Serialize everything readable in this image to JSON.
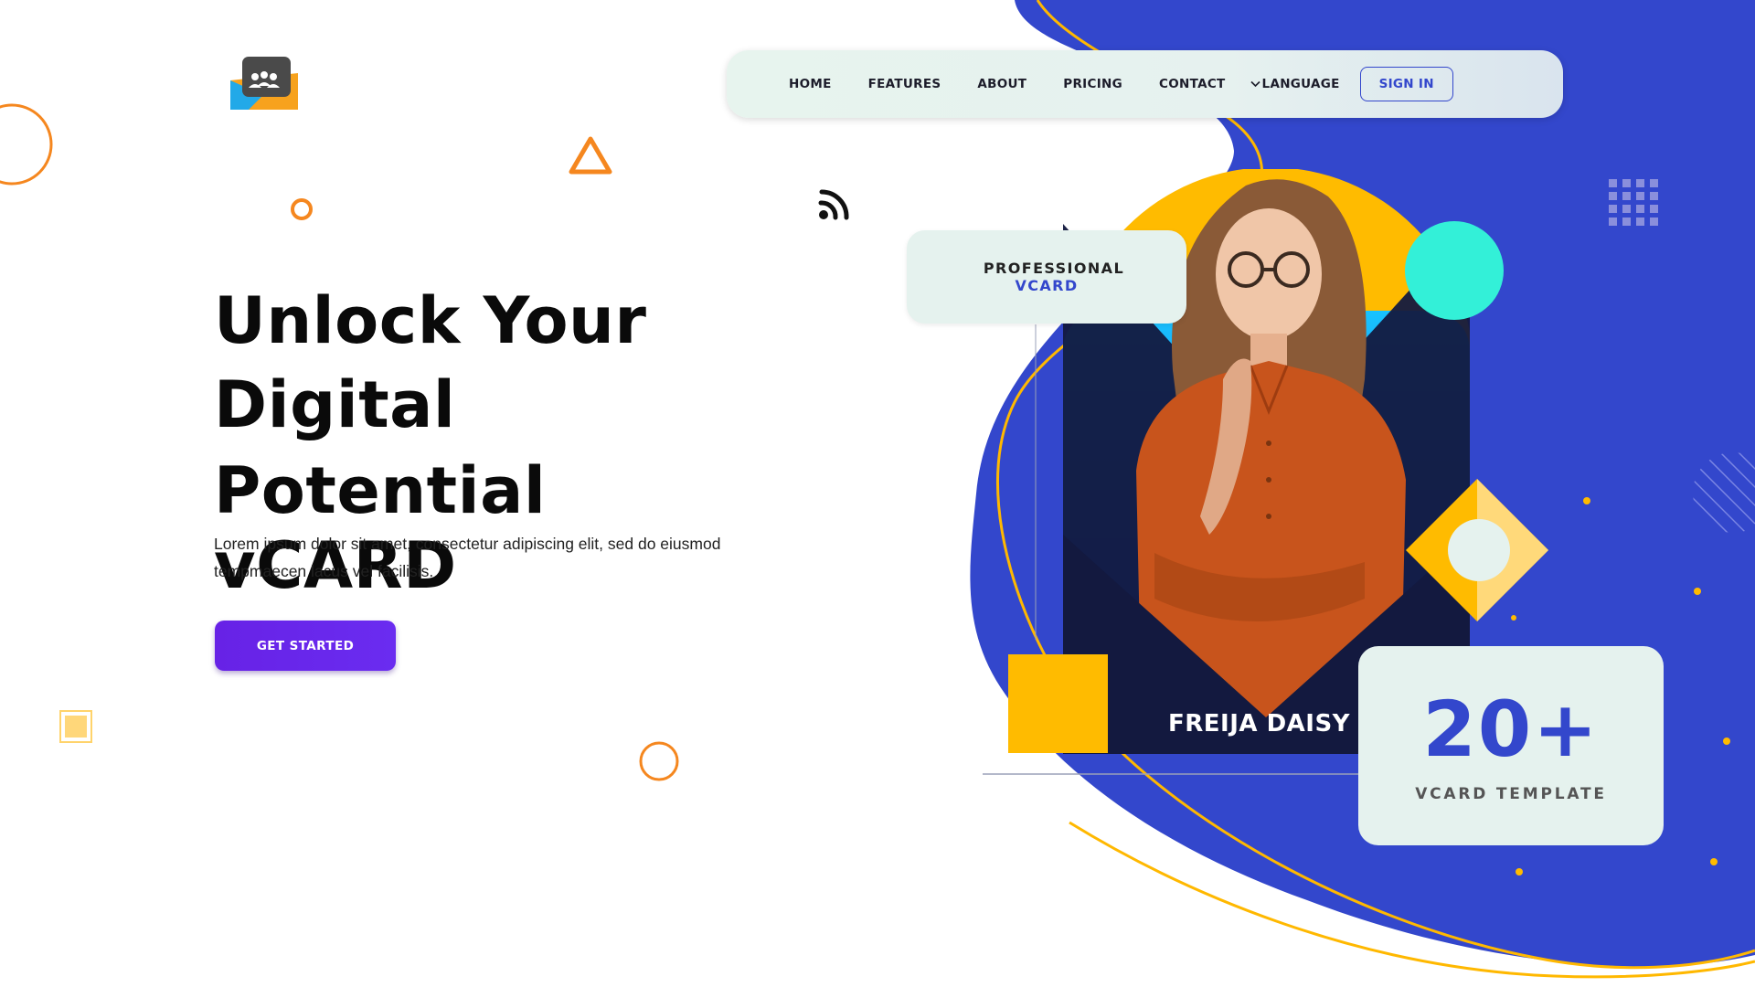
{
  "nav": {
    "home": "HOME",
    "features": "FEATURES",
    "about": "ABOUT",
    "pricing": "PRICING",
    "contact": "CONTACT",
    "language": "LANGUAGE",
    "sign_in": "SIGN IN"
  },
  "hero": {
    "title_line1": "Unlock Your Digital",
    "title_line2": "Potential",
    "title_line3": "vCARD",
    "subtitle": "Lorem ipsum dolor sit amet, consectetur adipiscing elit, sed do eiusmod tempmaecen lacus vel facilisis.",
    "cta_label": "GET STARTED"
  },
  "badge": {
    "line1": "PROFESSIONAL",
    "line2": "VCARD"
  },
  "card": {
    "name": "FREIJA DAISY"
  },
  "stats": {
    "number": "20+",
    "label": "VCARD TEMPLATE"
  },
  "icons": {
    "logo": "people-chat-logo-icon",
    "language": "chevron-down-icon",
    "decor": [
      "orange-ring-icon",
      "orange-triangle-icon",
      "wifi-signal-icon",
      "dot-grid-icon",
      "yellow-square-icon"
    ]
  },
  "colors": {
    "brand_blue": "#3347cc",
    "cta_purple": "#6722e6",
    "accent_yellow": "#ffb800",
    "accent_orange": "#f5871f",
    "accent_teal": "#33f0d8",
    "panel_mint": "#e5f2ee"
  }
}
